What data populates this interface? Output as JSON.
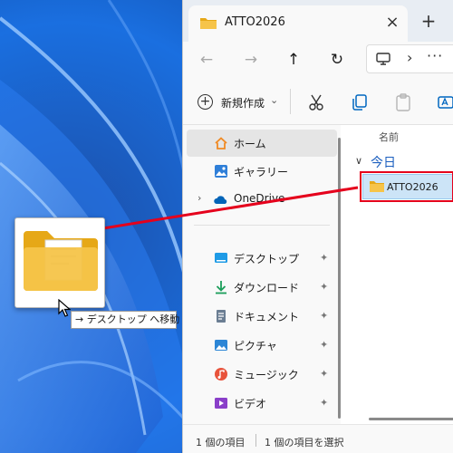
{
  "window": {
    "tab_title": "ATTO2026",
    "tab_close": "×",
    "new_tab": "+"
  },
  "navbar": {
    "back": "←",
    "forward": "→",
    "up": "↑",
    "refresh": "↻",
    "chevron": "›",
    "more": "···"
  },
  "toolbar": {
    "new_label": "新規作成",
    "new_caret": "⌄",
    "icons": [
      "cut-icon",
      "copy-icon",
      "paste-icon",
      "rename-icon"
    ]
  },
  "nav_pane": {
    "items": [
      {
        "label": "ホーム",
        "icon": "home-icon"
      },
      {
        "label": "ギャラリー",
        "icon": "gallery-icon"
      },
      {
        "label": "OneDrive",
        "icon": "onedrive-icon"
      },
      {
        "label": "デスクトップ",
        "icon": "desktop-icon"
      },
      {
        "label": "ダウンロード",
        "icon": "download-icon"
      },
      {
        "label": "ドキュメント",
        "icon": "document-icon"
      },
      {
        "label": "ピクチャ",
        "icon": "picture-icon"
      },
      {
        "label": "ミュージック",
        "icon": "music-icon"
      },
      {
        "label": "ビデオ",
        "icon": "video-icon"
      }
    ],
    "expander": "›",
    "pin": "📌"
  },
  "content": {
    "column_name": "名前",
    "group_label": "今日",
    "group_chevron": "∨",
    "file_name": "ATTO2026"
  },
  "status": {
    "count": "1 個の項目",
    "selected": "1 個の項目を選択"
  },
  "drag": {
    "tooltip": "→ デスクトップ へ移動"
  },
  "colors": {
    "accent": "#0067c0",
    "highlight": "#e5001c",
    "folder": "#f6c449"
  }
}
